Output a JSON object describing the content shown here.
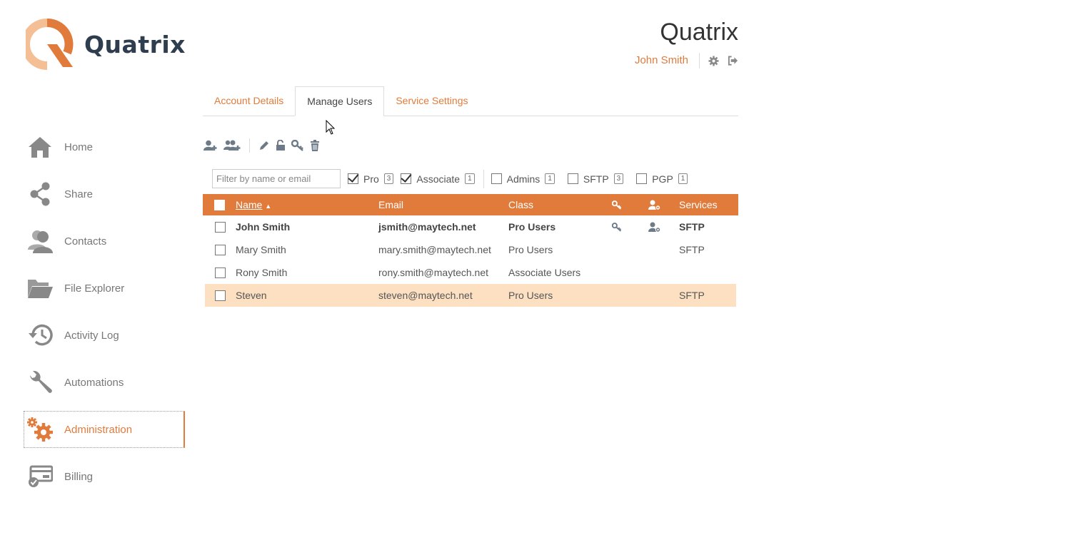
{
  "brand": {
    "logo_text": "Quatrix",
    "accent": "#e07b3c",
    "logo_light": "#f5bf96"
  },
  "header": {
    "app_title": "Quatrix",
    "user_name": "John Smith"
  },
  "sidebar": {
    "items": [
      {
        "label": "Home",
        "icon": "home-icon"
      },
      {
        "label": "Share",
        "icon": "share-icon"
      },
      {
        "label": "Contacts",
        "icon": "contacts-icon"
      },
      {
        "label": "File Explorer",
        "icon": "folder-icon"
      },
      {
        "label": "Activity Log",
        "icon": "history-icon"
      },
      {
        "label": "Automations",
        "icon": "wrench-icon"
      },
      {
        "label": "Administration",
        "icon": "gears-icon",
        "active": true
      },
      {
        "label": "Billing",
        "icon": "billing-icon"
      }
    ]
  },
  "tabs": [
    {
      "label": "Account Details"
    },
    {
      "label": "Manage Users",
      "active": true
    },
    {
      "label": "Service Settings"
    }
  ],
  "filters": {
    "search_placeholder": "Filter by name or email",
    "items": [
      {
        "label": "Pro",
        "count": "3",
        "checked": true
      },
      {
        "label": "Associate",
        "count": "1",
        "checked": true
      },
      {
        "label": "Admins",
        "count": "1",
        "checked": false
      },
      {
        "label": "SFTP",
        "count": "3",
        "checked": false
      },
      {
        "label": "PGP",
        "count": "1",
        "checked": false
      }
    ]
  },
  "table": {
    "headers": {
      "name": "Name",
      "email": "Email",
      "class": "Class",
      "services": "Services"
    },
    "rows": [
      {
        "name": "John Smith",
        "email": "jsmith@maytech.net",
        "class": "Pro Users",
        "services": "SFTP"
      },
      {
        "name": "Mary Smith",
        "email": "mary.smith@maytech.net",
        "class": "Pro Users",
        "services": "SFTP"
      },
      {
        "name": "Rony Smith",
        "email": "rony.smith@maytech.net",
        "class": "Associate Users",
        "services": ""
      },
      {
        "name": "Steven",
        "email": "steven@maytech.net",
        "class": "Pro Users",
        "services": "SFTP"
      }
    ]
  }
}
